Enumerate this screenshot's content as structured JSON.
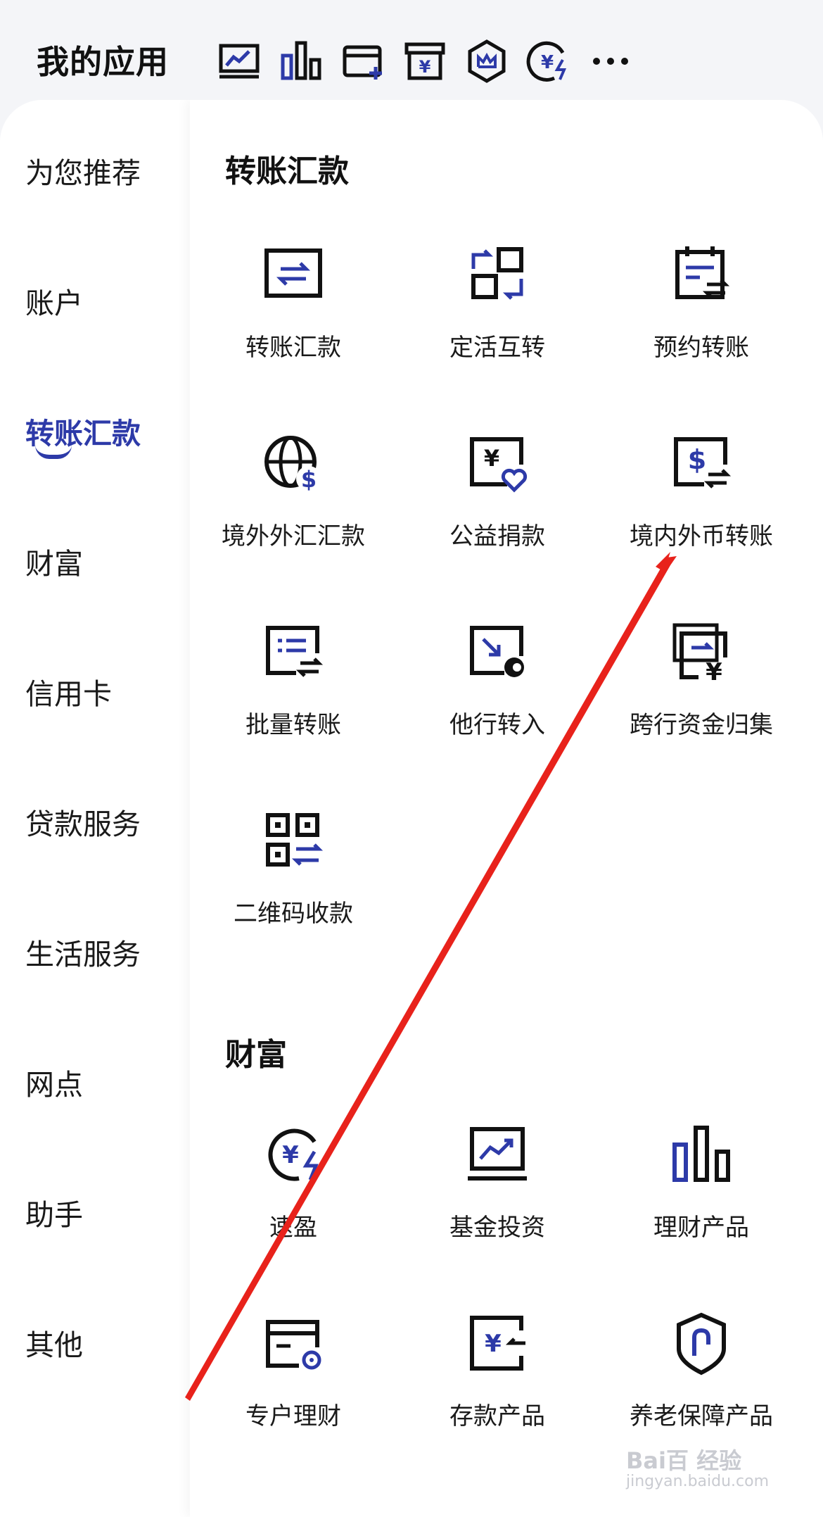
{
  "header": {
    "title": "我的应用",
    "icons": [
      "trend-chart-icon",
      "bar-chart-icon",
      "card-add-icon",
      "archive-yuan-icon",
      "crown-shield-icon",
      "fast-yuan-icon",
      "more-icon"
    ]
  },
  "sidebar": {
    "items": [
      {
        "label": "为您推荐"
      },
      {
        "label": "账户"
      },
      {
        "label": "转账汇款"
      },
      {
        "label": "财富"
      },
      {
        "label": "信用卡"
      },
      {
        "label": "贷款服务"
      },
      {
        "label": "生活服务"
      },
      {
        "label": "网点"
      },
      {
        "label": "助手"
      },
      {
        "label": "其他"
      }
    ],
    "active_index": 2
  },
  "sections": [
    {
      "title": "转账汇款",
      "items": [
        {
          "label": "转账汇款",
          "icon": "transfer-icon"
        },
        {
          "label": "定活互转",
          "icon": "fixed-current-swap-icon"
        },
        {
          "label": "预约转账",
          "icon": "scheduled-transfer-icon"
        },
        {
          "label": "境外外汇汇款",
          "icon": "globe-dollar-icon"
        },
        {
          "label": "公益捐款",
          "icon": "donation-icon"
        },
        {
          "label": "境内外币转账",
          "icon": "foreign-currency-transfer-icon"
        },
        {
          "label": "批量转账",
          "icon": "batch-transfer-icon"
        },
        {
          "label": "他行转入",
          "icon": "other-bank-inflow-icon"
        },
        {
          "label": "跨行资金归集",
          "icon": "fund-collection-icon"
        },
        {
          "label": "二维码收款",
          "icon": "qr-collect-icon"
        }
      ]
    },
    {
      "title": "财富",
      "items": [
        {
          "label": "速盈",
          "icon": "quick-yield-icon"
        },
        {
          "label": "基金投资",
          "icon": "fund-investment-icon"
        },
        {
          "label": "理财产品",
          "icon": "wealth-product-icon"
        },
        {
          "label": "专户理财",
          "icon": "dedicated-account-icon"
        },
        {
          "label": "存款产品",
          "icon": "deposit-product-icon"
        },
        {
          "label": "养老保障产品",
          "icon": "pension-shield-icon"
        }
      ]
    }
  ],
  "watermark": {
    "brand": "Bai百 经验",
    "url": "jingyan.baidu.com"
  },
  "colors": {
    "accent": "#2d3aa8",
    "icon_dark": "#111111",
    "annotation_arrow": "#e8221b"
  }
}
